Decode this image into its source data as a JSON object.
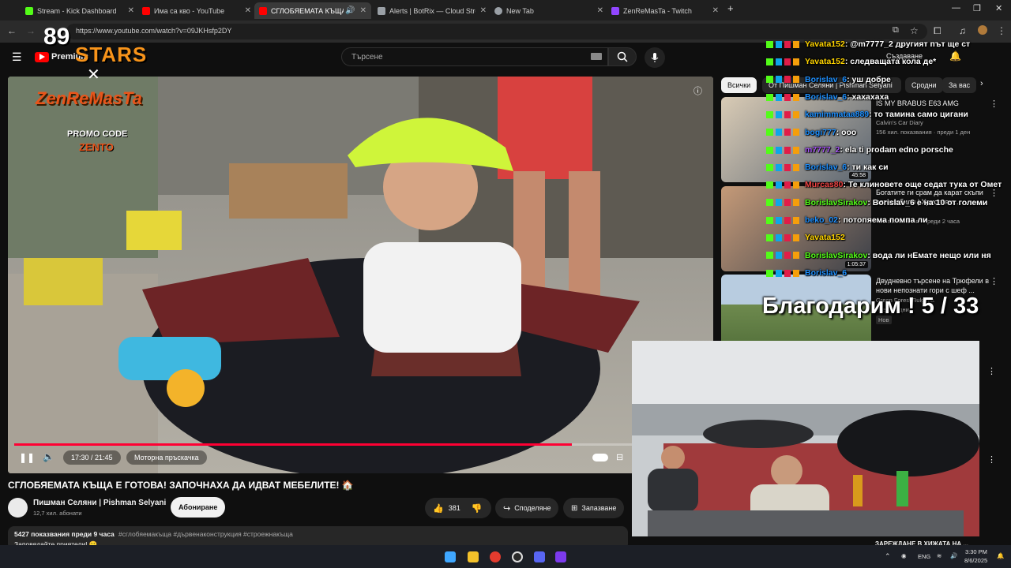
{
  "browser": {
    "tabs": [
      {
        "label": "Stream - Kick Dashboard",
        "color": "#53fc18",
        "active": false
      },
      {
        "label": "Има са кво - YouTube",
        "color": "#ff0000",
        "active": false
      },
      {
        "label": "СГЛОБЯЕМАТА КЪЩА Е ГО",
        "color": "#ff0000",
        "active": true
      },
      {
        "label": "Alerts | BotRix — Cloud Stream",
        "color": "#9aa0a6",
        "active": false
      },
      {
        "label": "New Tab",
        "color": "#9aa0a6",
        "active": false
      },
      {
        "label": "ZenReMasTa - Twitch",
        "color": "#9146ff",
        "active": false
      }
    ],
    "new_tab_glyph": "+",
    "url": "https://www.youtube.com/watch?v=09JKHsfp2DY"
  },
  "youtube": {
    "logo": "Premium",
    "search_placeholder": "Търсене",
    "create_label": "Създаване",
    "video": {
      "time": "17:30 / 21:45",
      "chapter": "Моторна пръскачка",
      "progress": 0.8046
    },
    "title": "СГЛОБЯЕМАТА КЪЩА Е ГОТОВА! ЗАПОЧНАХА ДА ИДВАТ МЕБЕЛИТЕ! 🏠",
    "channel": {
      "name": "Пишман Селяни | Pishman Selyani",
      "subs": "12,7 хил. абонати"
    },
    "subscribe_label": "Абониране",
    "likes": "381",
    "share_label": "Споделяне",
    "save_label": "Запазване",
    "meta": "5427 показвания  преди 9 часа",
    "hashtags": "#сглобяемакъща #дървенаконструкция #строежнакъща",
    "desc_line": "Заповядайте приятели! 🙂",
    "chips": [
      "Всички",
      "От Пишман Селяни | Pishman Selyani",
      "Сродни",
      "За вас"
    ],
    "recs": [
      {
        "title": "IS MY BRABUS E63 AMG",
        "channel": "Calvin's Car Diary",
        "stats": "156 хил. показвания · преди 1 ден",
        "duration": "45:58"
      },
      {
        "title": "Богатите ги срам да карат скъпи автомобили | Християн ...",
        "channel": "",
        "stats": "439 показвания · преди 2 часа",
        "duration": "1:05:37"
      },
      {
        "title": "Двудневно търсене на Трюфели в нови непознати гори с шеф ...",
        "channel": "Green Forest Bulgaria",
        "stats": "преди 4 дни",
        "duration": "",
        "badge": "Нов"
      }
    ],
    "bottom_rec_title": "ЗАРЕЖДАНЕ В ХИЖАТА НА ..."
  },
  "overlay": {
    "stars_logo": "STARS",
    "stars_number": "89",
    "promo_brand": "ZenReMasTa",
    "promo_code": "PROMO CODE",
    "promo_word": "ZENTO",
    "thanks": "Благодарим ! 5 / 33",
    "chat": [
      {
        "user": "Yavata152",
        "user_color": "#ffd400",
        "text": ": @m7777_2 другият път ще ст"
      },
      {
        "user": "Yavata152",
        "user_color": "#ffd400",
        "text": ": следващата кола де*"
      },
      {
        "user": "Borislav_6",
        "user_color": "#1e90ff",
        "text": ": уш добре"
      },
      {
        "user": "Borislav_6",
        "user_color": "#1e90ff",
        "text": ": хахахаха"
      },
      {
        "user": "kamimmataa889",
        "user_color": "#1e90ff",
        "text": ": то тамина само цигани"
      },
      {
        "user": "bogi777",
        "user_color": "#1e90ff",
        "text": ": ооо"
      },
      {
        "user": "m7777_2",
        "user_color": "#a855f7",
        "text": ": ela ti prodam edno porsche"
      },
      {
        "user": "Borislav_6",
        "user_color": "#1e90ff",
        "text": ": ти как си"
      },
      {
        "user": "Murcas80",
        "user_color": "#ef4444",
        "text": ": Те клиновете още седат тука от Омет"
      },
      {
        "user": "BorislavSirakov",
        "user_color": "#53fc18",
        "text": ": Borislav_6 е на 10 от големи"
      },
      {
        "user": "beko_02",
        "user_color": "#1e90ff",
        "text": ": потопяема помпа ли"
      },
      {
        "user": "Yavata152",
        "user_color": "#ffd400",
        "text": ""
      },
      {
        "user": "BorislavSirakov",
        "user_color": "#53fc18",
        "text": ": вода ли нЕмате нещо или ня"
      },
      {
        "user": "Borislav_6",
        "user_color": "#1e90ff",
        "text": ""
      }
    ]
  },
  "taskbar": {
    "lang": "ENG",
    "time": "3:30 PM",
    "date": "8/6/2025"
  }
}
